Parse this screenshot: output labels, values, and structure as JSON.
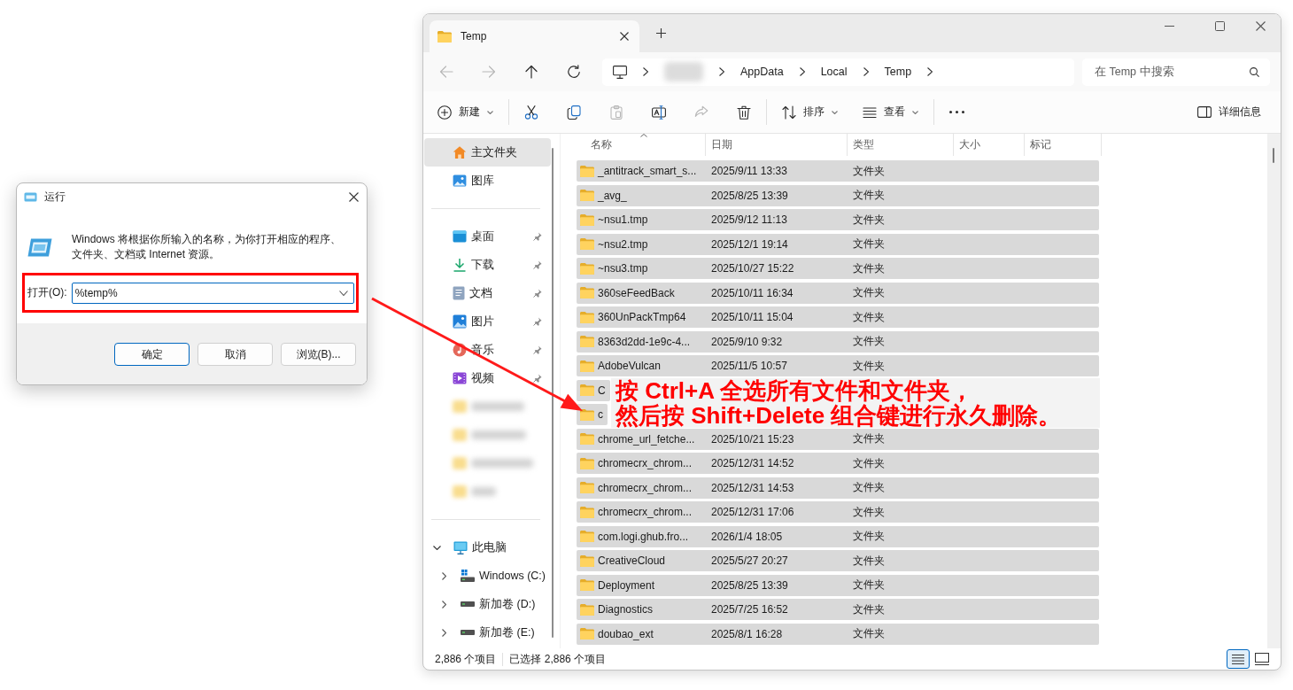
{
  "run_dialog": {
    "title": "运行",
    "description": "Windows 将根据你所输入的名称，为你打开相应的程序、文件夹、文档或 Internet 资源。",
    "open_field": {
      "label": "打开(O):",
      "value": "%temp%",
      "focused": true
    },
    "buttons": [
      {
        "label": "确定",
        "default": true
      },
      {
        "label": "取消",
        "default": false
      },
      {
        "label": "浏览(B)...",
        "default": false
      }
    ]
  },
  "explorer": {
    "tabs": [
      {
        "label": "Temp",
        "selected": true
      }
    ],
    "nav_buttons": [
      {
        "kind": "back",
        "disabled": true
      },
      {
        "kind": "forward",
        "disabled": true
      },
      {
        "kind": "up",
        "disabled": false
      },
      {
        "kind": "refresh",
        "disabled": false
      }
    ],
    "breadcrumb": [
      {
        "kind": "computer"
      },
      {
        "kind": "blurred"
      },
      {
        "kind": "folder",
        "label": "AppData"
      },
      {
        "kind": "folder",
        "label": "Local"
      },
      {
        "kind": "folder",
        "label": "Temp"
      }
    ],
    "search": {
      "placeholder": "在 Temp 中搜索"
    },
    "toolbar": [
      {
        "kind": "new",
        "label": "新建",
        "disabled": false
      },
      {
        "kind": "separator"
      },
      {
        "kind": "cut",
        "disabled": false
      },
      {
        "kind": "copy",
        "disabled": false
      },
      {
        "kind": "paste",
        "disabled": true
      },
      {
        "kind": "rename",
        "disabled": false
      },
      {
        "kind": "share",
        "disabled": true
      },
      {
        "kind": "delete",
        "disabled": false
      },
      {
        "kind": "separator"
      },
      {
        "kind": "sort",
        "label": "排序",
        "disabled": false
      },
      {
        "kind": "view",
        "label": "查看",
        "disabled": false
      },
      {
        "kind": "separator"
      },
      {
        "kind": "more",
        "disabled": false
      }
    ],
    "details_button": {
      "label": "详细信息"
    },
    "sidebar": {
      "top_items": [
        {
          "label": "主文件夹",
          "selected": true
        },
        {
          "label": "图库",
          "selected": false
        }
      ],
      "quick_access": [
        {
          "kind": "pinned",
          "label": "桌面",
          "selected": false
        },
        {
          "kind": "pinned",
          "label": "下载",
          "selected": false
        },
        {
          "kind": "pinned",
          "label": "文档",
          "selected": false
        },
        {
          "kind": "pinned",
          "label": "图片",
          "selected": false
        },
        {
          "kind": "pinned",
          "label": "音乐",
          "selected": false
        },
        {
          "kind": "pinned",
          "label": "视频",
          "selected": false
        },
        {
          "kind": "blurred"
        },
        {
          "kind": "blurred"
        },
        {
          "kind": "blurred"
        },
        {
          "kind": "blurred"
        }
      ],
      "this_pc": {
        "label": "此电脑",
        "expanded": true,
        "children": [
          {
            "label": "Windows (C:)",
            "expanded": false
          },
          {
            "label": "新加卷 (D:)",
            "expanded": false
          },
          {
            "label": "新加卷 (E:)",
            "expanded": false
          }
        ]
      }
    },
    "columns": [
      {
        "label": "名称",
        "sorted": true
      },
      {
        "label": "日期",
        "sorted": false
      },
      {
        "label": "类型",
        "sorted": false
      },
      {
        "label": "大小",
        "sorted": false
      },
      {
        "label": "标记",
        "sorted": false
      }
    ],
    "rows": [
      {
        "name": "_antitrack_smart_s...",
        "date": "2025/9/11 13:33",
        "type": "文件夹",
        "selected": true
      },
      {
        "name": "_avg_",
        "date": "2025/8/25 13:39",
        "type": "文件夹",
        "selected": true
      },
      {
        "name": "~nsu1.tmp",
        "date": "2025/9/12 11:13",
        "type": "文件夹",
        "selected": true
      },
      {
        "name": "~nsu2.tmp",
        "date": "2025/12/1 19:14",
        "type": "文件夹",
        "selected": true
      },
      {
        "name": "~nsu3.tmp",
        "date": "2025/10/27 15:22",
        "type": "文件夹",
        "selected": true
      },
      {
        "name": "360seFeedBack",
        "date": "2025/10/11 16:34",
        "type": "文件夹",
        "selected": true
      },
      {
        "name": "360UnPackTmp64",
        "date": "2025/10/11 15:04",
        "type": "文件夹",
        "selected": true
      },
      {
        "name": "8363d2dd-1e9c-4...",
        "date": "2025/9/10 9:32",
        "type": "文件夹",
        "selected": true
      },
      {
        "name": "AdobeVulcan",
        "date": "2025/11/5 10:57",
        "type": "文件夹",
        "selected": true
      },
      {
        "name": "C",
        "selected": true
      },
      {
        "name": "c",
        "selected": true
      },
      {
        "name": "chrome_url_fetche...",
        "date": "2025/10/21 15:23",
        "type": "文件夹",
        "selected": true
      },
      {
        "name": "chromecrx_chrom...",
        "date": "2025/12/31 14:52",
        "type": "文件夹",
        "selected": true
      },
      {
        "name": "chromecrx_chrom...",
        "date": "2025/12/31 14:53",
        "type": "文件夹",
        "selected": true
      },
      {
        "name": "chromecrx_chrom...",
        "date": "2025/12/31 17:06",
        "type": "文件夹",
        "selected": true
      },
      {
        "name": "com.logi.ghub.fro...",
        "date": "2026/1/4 18:05",
        "type": "文件夹",
        "selected": true
      },
      {
        "name": "CreativeCloud",
        "date": "2025/5/27 20:27",
        "type": "文件夹",
        "selected": true
      },
      {
        "name": "Deployment",
        "date": "2025/8/25 13:39",
        "type": "文件夹",
        "selected": true
      },
      {
        "name": "Diagnostics",
        "date": "2025/7/25 16:52",
        "type": "文件夹",
        "selected": true
      },
      {
        "name": "doubao_ext",
        "date": "2025/8/1 16:28",
        "type": "文件夹",
        "selected": true
      }
    ],
    "status_bar": {
      "item_count": "2,886 个项目",
      "selection": "已选择 2,886 个项目",
      "view_modes": [
        {
          "selected": true
        },
        {
          "selected": false
        }
      ]
    }
  },
  "annotation": {
    "lines": [
      "按 Ctrl+A 全选所有文件和文件夹，",
      "然后按 Shift+Delete 组合键进行永久删除。"
    ]
  }
}
